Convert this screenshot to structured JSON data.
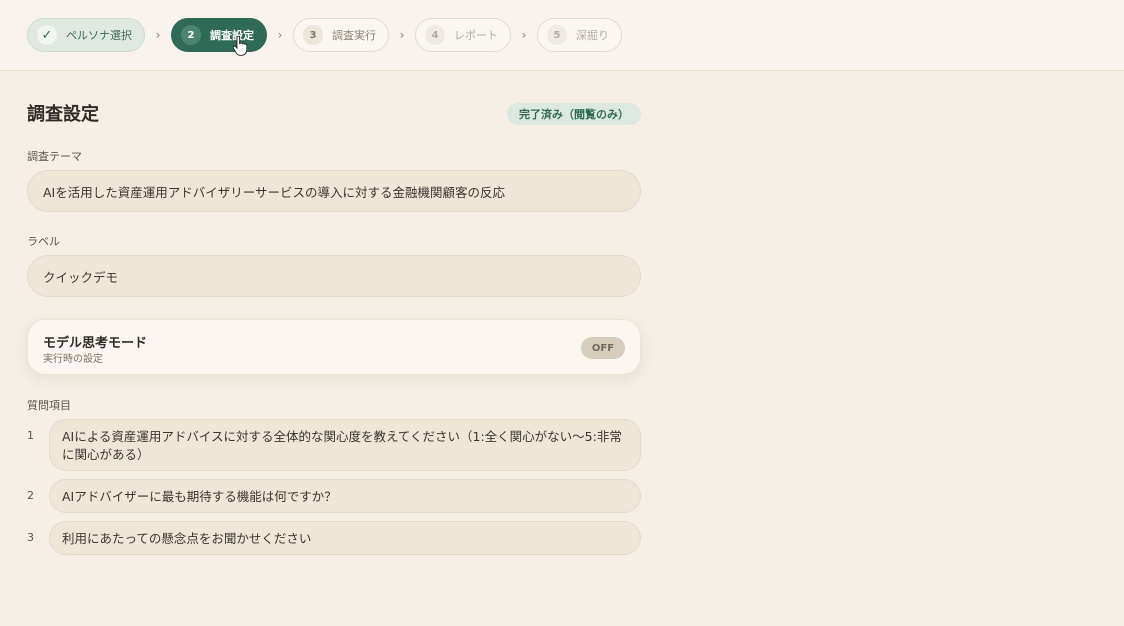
{
  "steps": [
    {
      "num": "✓",
      "label": "ペルソナ選択",
      "state": "done"
    },
    {
      "num": "2",
      "label": "調査設定",
      "state": "active"
    },
    {
      "num": "3",
      "label": "調査実行",
      "state": "pending"
    },
    {
      "num": "4",
      "label": "レポート",
      "state": "dim"
    },
    {
      "num": "5",
      "label": "深掘り",
      "state": "dim"
    }
  ],
  "separator": "›",
  "page": {
    "title": "調査設定",
    "badge": "完了済み（閲覧のみ）"
  },
  "theme": {
    "label": "調査テーマ",
    "value": "AIを活用した資産運用アドバイザリーサービスの導入に対する金融機関顧客の反応"
  },
  "tag": {
    "label": "ラベル",
    "value": "クイックデモ"
  },
  "model_mode": {
    "title": "モデル思考モード",
    "subtitle": "実行時の設定",
    "state": "OFF"
  },
  "questions": {
    "label": "質問項目",
    "items": [
      {
        "num": "1",
        "text": "AIによる資産運用アドバイスに対する全体的な関心度を教えてください（1:全く関心がない〜5:非常に関心がある）"
      },
      {
        "num": "2",
        "text": "AIアドバイザーに最も期待する機能は何ですか？"
      },
      {
        "num": "3",
        "text": "利用にあたっての懸念点をお聞かせください"
      }
    ]
  },
  "colors": {
    "accent": "#2e6a55",
    "background": "#f5efe6"
  }
}
